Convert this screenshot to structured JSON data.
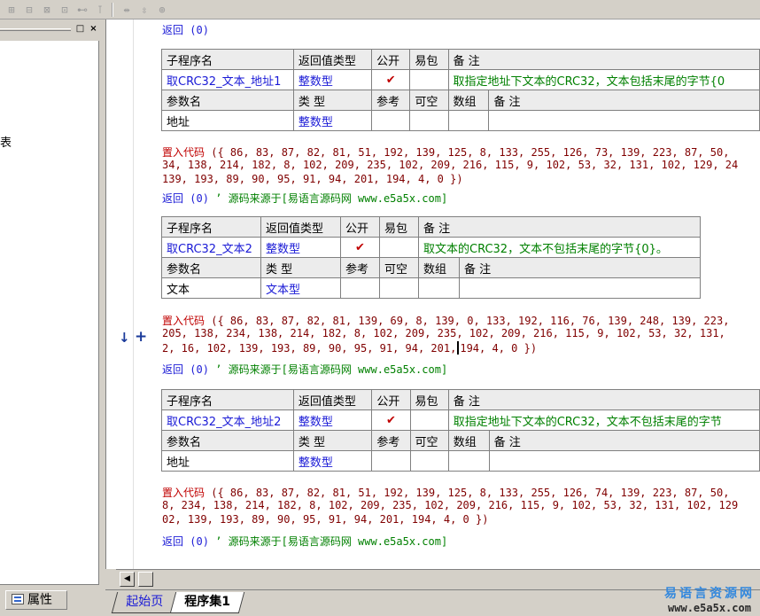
{
  "toolbar": {
    "icons": [
      "align-left-icon",
      "align-center-icon",
      "align-top-icon",
      "align-middle-icon",
      "equal-width-icon",
      "equal-height-icon",
      "horizontal-space-icon",
      "vertical-space-icon",
      "center-in-window-icon"
    ],
    "glyphs": [
      "⊞",
      "⊟",
      "⊠",
      "⊡",
      "⊷",
      "⊺",
      "⇹",
      "⇳",
      "⊕"
    ]
  },
  "left_panel": {
    "fragment": "表",
    "pin_label": "□",
    "close_label": "×",
    "tab_label": "属性"
  },
  "editor": {
    "return_label": "返回",
    "blocks": [
      {
        "top_return": {
          "kw": "返回",
          "args": " (0)"
        },
        "header": {
          "name": "子程序名",
          "rtype": "返回值类型",
          "public": "公开",
          "easy": "易包",
          "note": "备 注"
        },
        "row": {
          "name": "取CRC32_文本_地址1",
          "rtype": "整数型",
          "public": "✔",
          "note": "取指定地址下文本的CRC32，文本包括末尾的字节{0"
        },
        "param_header": {
          "name": "参数名",
          "type": "类 型",
          "ref": "参考",
          "nullable": "可空",
          "array": "数组",
          "note": "备 注"
        },
        "param_row": {
          "name": "地址",
          "type": "整数型"
        },
        "code": {
          "kw": "置入代码",
          "line1": " ({ 86, 83, 87, 82, 81, 51, 192, 139, 125, 8, 133, 255, 126, 73, 139, 223, 87, 50,",
          "line2": "34, 138, 214, 182, 8, 102, 209, 235, 102, 209, 216, 115, 9, 102, 53, 32, 131, 102, 129, 24",
          "line3": "139, 193, 89, 90, 95, 91, 94, 201, 194, 4, 0 })"
        },
        "ret": {
          "kw": "返回",
          "args": " (0) ",
          "comment": "’ 源码来源于[易语言源码网 www.e5a5x.com]"
        }
      },
      {
        "header": {
          "name": "子程序名",
          "rtype": "返回值类型",
          "public": "公开",
          "easy": "易包",
          "note": "备 注"
        },
        "row": {
          "name": "取CRC32_文本2",
          "rtype": "整数型",
          "public": "✔",
          "note": "取文本的CRC32，文本不包括末尾的字节{0}。"
        },
        "param_header": {
          "name": "参数名",
          "type": "类 型",
          "ref": "参考",
          "nullable": "可空",
          "array": "数组",
          "note": "备 注"
        },
        "param_row": {
          "name": "文本",
          "type": "文本型"
        },
        "code": {
          "kw": "置入代码",
          "line1": " ({ 86, 83, 87, 82, 81, 139, 69, 8, 139, 0, 133, 192, 116, 76, 139, 248, 139, 223,",
          "line2": "205, 138, 234, 138, 214, 182, 8, 102, 209, 235, 102, 209, 216, 115, 9, 102, 53, 32, 131,",
          "line3a": "2, 16, 102, 139, 193, 89, 90, 95, 91, 94, 201,",
          "line3b": "194, 4, 0 })"
        },
        "ret": {
          "kw": "返回",
          "args": " (0) ",
          "comment": "’ 源码来源于[易语言源码网 www.e5a5x.com]"
        }
      },
      {
        "header": {
          "name": "子程序名",
          "rtype": "返回值类型",
          "public": "公开",
          "easy": "易包",
          "note": "备 注"
        },
        "row": {
          "name": "取CRC32_文本_地址2",
          "rtype": "整数型",
          "public": "✔",
          "note": "取指定地址下文本的CRC32，文本不包括末尾的字节"
        },
        "param_header": {
          "name": "参数名",
          "type": "类 型",
          "ref": "参考",
          "nullable": "可空",
          "array": "数组",
          "note": "备 注"
        },
        "param_row": {
          "name": "地址",
          "type": "整数型"
        },
        "code": {
          "kw": "置入代码",
          "line1": " ({ 86, 83, 87, 82, 81, 51, 192, 139, 125, 8, 133, 255, 126, 74, 139, 223, 87, 50,",
          "line2": "8, 234, 138, 214, 182, 8, 102, 209, 235, 102, 209, 216, 115, 9, 102, 53, 32, 131, 102, 129",
          "line3": "02, 139, 193, 89, 90, 95, 91, 94, 201, 194, 4, 0 })"
        },
        "ret": {
          "kw": "返回",
          "args": " (0) ",
          "comment": "’ 源码来源于[易语言源码网 www.e5a5x.com]"
        }
      }
    ]
  },
  "gutter": {
    "arrow": "↓",
    "plus": "+"
  },
  "scrollbar": {
    "left_arrow": "◀"
  },
  "tabs": {
    "start": "起始页",
    "active": "程序集1"
  },
  "watermark": {
    "title": "易语言资源网",
    "url": "www.e5a5x.com"
  },
  "colors": {
    "keyword": "#1a1ad6",
    "comment": "#008000",
    "code_kw": "#c00000",
    "check": "#c00000"
  }
}
